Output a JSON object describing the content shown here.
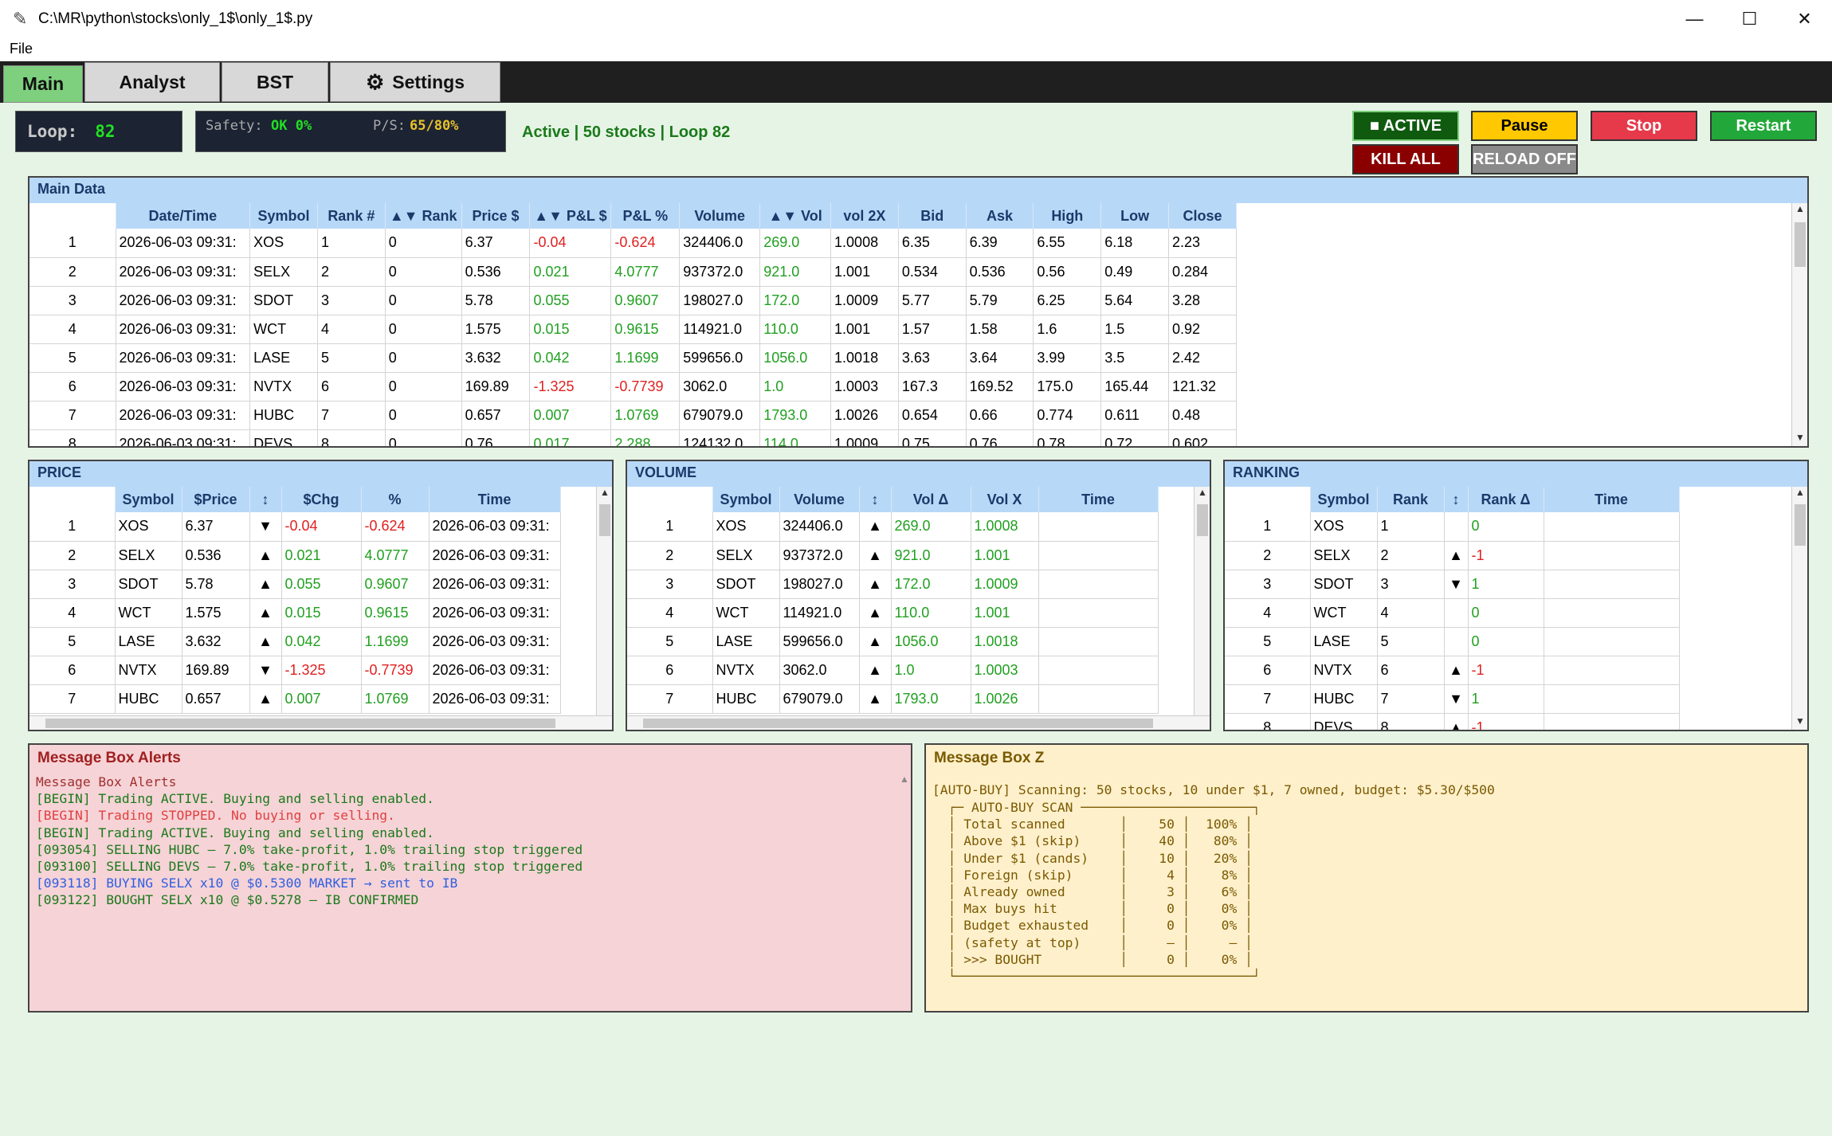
{
  "window": {
    "title": "C:\\MR\\python\\stocks\\only_1$\\only_1$.py",
    "minimize": "—",
    "maximize": "☐",
    "close": "✕"
  },
  "menu": {
    "file": "File"
  },
  "tabs": [
    {
      "label": "Main",
      "active": true
    },
    {
      "label": "Analyst"
    },
    {
      "label": "BST"
    },
    {
      "label": "Settings",
      "icon": "gear-icon"
    }
  ],
  "loop": {
    "label": "Loop:",
    "value": "82"
  },
  "safety": {
    "label": "Safety:",
    "value": "OK 0%",
    "ps_label": "P/S:",
    "ps_value": "65/80%"
  },
  "status_text": "Active | 50 stocks | Loop 82",
  "buttons": {
    "active": "■ ACTIVE",
    "pause": "Pause",
    "stop": "Stop",
    "restart": "Restart",
    "kill_all": "KILL ALL",
    "reload": "RELOAD OFF"
  },
  "colors": {
    "pos": "#20a020",
    "neg": "#e02020",
    "active_tab": "#7ed07e"
  },
  "main_data": {
    "title": "Main Data",
    "columns": [
      "",
      "Date/Time",
      "Symbol",
      "Rank #",
      "▲▼ Rank",
      "Price $",
      "▲▼ P&L $",
      "P&L %",
      "Volume",
      "▲▼ Vol",
      "vol 2X",
      "Bid",
      "Ask",
      "High",
      "Low",
      "Close"
    ],
    "rows": [
      [
        "1",
        "2026-06-03 09:31:",
        "XOS",
        "1",
        "0",
        "6.37",
        "-0.04",
        "-0.624",
        "324406.0",
        "269.0",
        "1.0008",
        "6.35",
        "6.39",
        "6.55",
        "6.18",
        "2.23"
      ],
      [
        "2",
        "2026-06-03 09:31:",
        "SELX",
        "2",
        "0",
        "0.536",
        "0.021",
        "4.0777",
        "937372.0",
        "921.0",
        "1.001",
        "0.534",
        "0.536",
        "0.56",
        "0.49",
        "0.284"
      ],
      [
        "3",
        "2026-06-03 09:31:",
        "SDOT",
        "3",
        "0",
        "5.78",
        "0.055",
        "0.9607",
        "198027.0",
        "172.0",
        "1.0009",
        "5.77",
        "5.79",
        "6.25",
        "5.64",
        "3.28"
      ],
      [
        "4",
        "2026-06-03 09:31:",
        "WCT",
        "4",
        "0",
        "1.575",
        "0.015",
        "0.9615",
        "114921.0",
        "110.0",
        "1.001",
        "1.57",
        "1.58",
        "1.6",
        "1.5",
        "0.92"
      ],
      [
        "5",
        "2026-06-03 09:31:",
        "LASE",
        "5",
        "0",
        "3.632",
        "0.042",
        "1.1699",
        "599656.0",
        "1056.0",
        "1.0018",
        "3.63",
        "3.64",
        "3.99",
        "3.5",
        "2.42"
      ],
      [
        "6",
        "2026-06-03 09:31:",
        "NVTX",
        "6",
        "0",
        "169.89",
        "-1.325",
        "-0.7739",
        "3062.0",
        "1.0",
        "1.0003",
        "167.3",
        "169.52",
        "175.0",
        "165.44",
        "121.32"
      ],
      [
        "7",
        "2026-06-03 09:31:",
        "HUBC",
        "7",
        "0",
        "0.657",
        "0.007",
        "1.0769",
        "679079.0",
        "1793.0",
        "1.0026",
        "0.654",
        "0.66",
        "0.774",
        "0.611",
        "0.48"
      ],
      [
        "8",
        "2026-06-03 09:31:",
        "DEVS",
        "8",
        "0",
        "0.76",
        "0.017",
        "2.288",
        "124132.0",
        "114.0",
        "1.0009",
        "0.75",
        "0.76",
        "0.78",
        "0.72",
        "0.602"
      ]
    ]
  },
  "price": {
    "title": "PRICE",
    "columns": [
      "",
      "Symbol",
      "$Price",
      "↕",
      "$Chg",
      "%",
      "Time"
    ],
    "rows": [
      [
        "1",
        "XOS",
        "6.37",
        "▼",
        "-0.04",
        "-0.624",
        "2026-06-03 09:31:"
      ],
      [
        "2",
        "SELX",
        "0.536",
        "▲",
        "0.021",
        "4.0777",
        "2026-06-03 09:31:"
      ],
      [
        "3",
        "SDOT",
        "5.78",
        "▲",
        "0.055",
        "0.9607",
        "2026-06-03 09:31:"
      ],
      [
        "4",
        "WCT",
        "1.575",
        "▲",
        "0.015",
        "0.9615",
        "2026-06-03 09:31:"
      ],
      [
        "5",
        "LASE",
        "3.632",
        "▲",
        "0.042",
        "1.1699",
        "2026-06-03 09:31:"
      ],
      [
        "6",
        "NVTX",
        "169.89",
        "▼",
        "-1.325",
        "-0.7739",
        "2026-06-03 09:31:"
      ],
      [
        "7",
        "HUBC",
        "0.657",
        "▲",
        "0.007",
        "1.0769",
        "2026-06-03 09:31:"
      ]
    ]
  },
  "volume": {
    "title": "VOLUME",
    "columns": [
      "",
      "Symbol",
      "Volume",
      "↕",
      "Vol Δ",
      "Vol X",
      "Time"
    ],
    "rows": [
      [
        "1",
        "XOS",
        "324406.0",
        "▲",
        "269.0",
        "1.0008",
        ""
      ],
      [
        "2",
        "SELX",
        "937372.0",
        "▲",
        "921.0",
        "1.001",
        ""
      ],
      [
        "3",
        "SDOT",
        "198027.0",
        "▲",
        "172.0",
        "1.0009",
        ""
      ],
      [
        "4",
        "WCT",
        "114921.0",
        "▲",
        "110.0",
        "1.001",
        ""
      ],
      [
        "5",
        "LASE",
        "599656.0",
        "▲",
        "1056.0",
        "1.0018",
        ""
      ],
      [
        "6",
        "NVTX",
        "3062.0",
        "▲",
        "1.0",
        "1.0003",
        ""
      ],
      [
        "7",
        "HUBC",
        "679079.0",
        "▲",
        "1793.0",
        "1.0026",
        ""
      ]
    ]
  },
  "ranking": {
    "title": "RANKING",
    "columns": [
      "",
      "Symbol",
      "Rank",
      "↕",
      "Rank Δ",
      "Time"
    ],
    "rows": [
      [
        "1",
        "XOS",
        "1",
        "",
        "0",
        ""
      ],
      [
        "2",
        "SELX",
        "2",
        "▲",
        "-1",
        ""
      ],
      [
        "3",
        "SDOT",
        "3",
        "▼",
        "1",
        ""
      ],
      [
        "4",
        "WCT",
        "4",
        "",
        "0",
        ""
      ],
      [
        "5",
        "LASE",
        "5",
        "",
        "0",
        ""
      ],
      [
        "6",
        "NVTX",
        "6",
        "▲",
        "-1",
        ""
      ],
      [
        "7",
        "HUBC",
        "7",
        "▼",
        "1",
        ""
      ],
      [
        "8",
        "DEVS",
        "8",
        "▲",
        "-1",
        ""
      ]
    ]
  },
  "alerts": {
    "title": "Message Box Alerts",
    "lines": [
      {
        "text": "Message Box Alerts",
        "color": "#a03030"
      },
      {
        "text": "[BEGIN] Trading ACTIVE. Buying and selling enabled.",
        "color": "#1a7a1a"
      },
      {
        "text": "[BEGIN] Trading STOPPED. No buying or selling.",
        "color": "#e04040"
      },
      {
        "text": "[BEGIN] Trading ACTIVE. Buying and selling enabled.",
        "color": "#1a7a1a"
      },
      {
        "text": "[093054] SELLING HUBC — 7.0% take-profit, 1.0% trailing stop triggered",
        "color": "#1a7a1a"
      },
      {
        "text": "[093100] SELLING DEVS — 7.0% take-profit, 1.0% trailing stop triggered",
        "color": "#1a7a1a"
      },
      {
        "text": "[093118] BUYING SELX x10 @ $0.5300 MARKET → sent to IB",
        "color": "#3060e0"
      },
      {
        "text": "[093122] BOUGHT SELX x10 @ $0.5278 — IB CONFIRMED",
        "color": "#1a7a1a"
      }
    ]
  },
  "msgz": {
    "title": "Message Box Z",
    "header": "[AUTO-BUY] Scanning: 50 stocks, 10 under $1, 7 owned, budget: $5.30/$500",
    "table": [
      "  ┌─ AUTO-BUY SCAN ──────────────────────┐",
      "  │ Total scanned       │    50 │  100% │",
      "  │ Above $1 (skip)     │    40 │   80% │",
      "  │ Under $1 (cands)    │    10 │   20% │",
      "  │ Foreign (skip)      │     4 │    8% │",
      "  │ Already owned       │     3 │    6% │",
      "  │ Max buys hit        │     0 │    0% │",
      "  │ Budget exhausted    │     0 │    0% │",
      "  │ (safety at top)     │     — │     — │",
      "  │ >>> BOUGHT          │     0 │    0% │",
      "  └──────────────────────────────────────┘"
    ]
  }
}
